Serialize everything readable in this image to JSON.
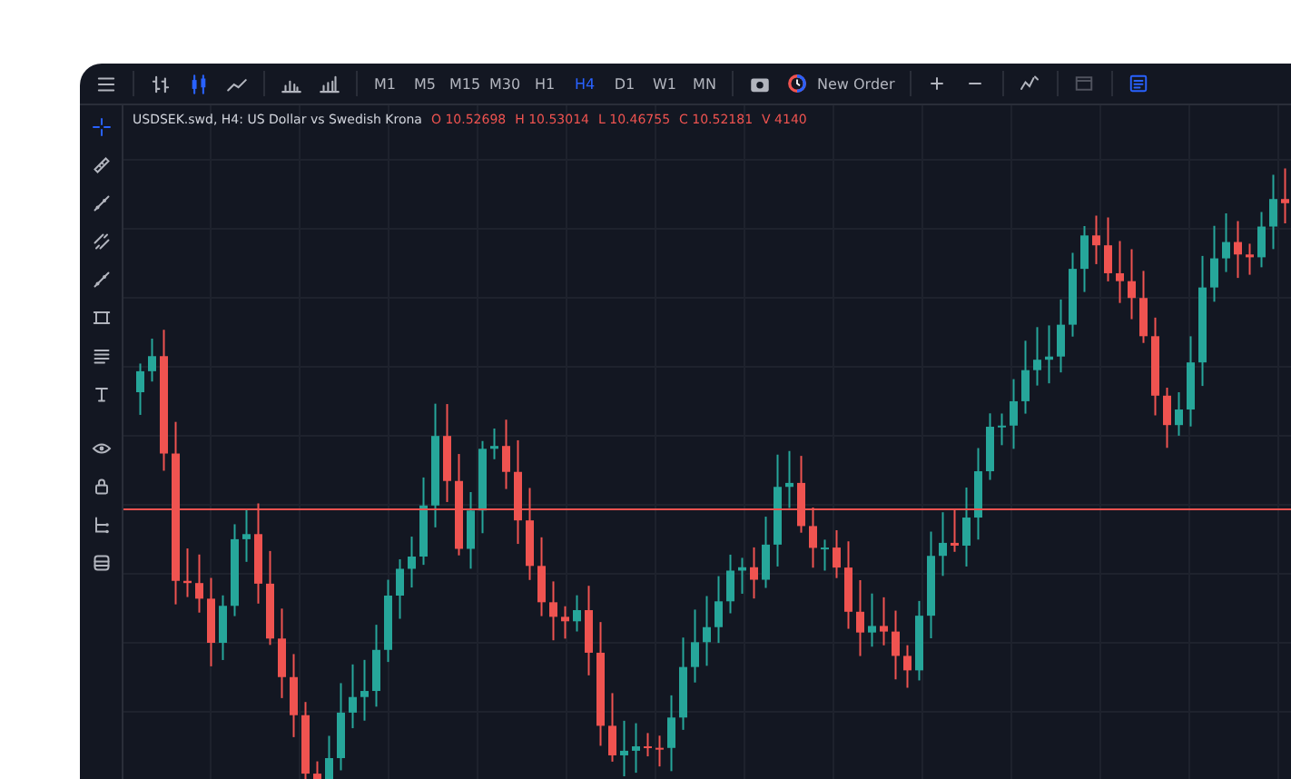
{
  "toolbar": {
    "chart_types": [
      {
        "kind": "bars",
        "selected": false
      },
      {
        "kind": "candles",
        "selected": true
      },
      {
        "kind": "line",
        "selected": false
      }
    ],
    "indicator_tools": [
      {
        "kind": "volumes"
      },
      {
        "kind": "indicator-chart"
      }
    ],
    "timeframes": [
      {
        "label": "M1",
        "selected": false
      },
      {
        "label": "M5",
        "selected": false
      },
      {
        "label": "M15",
        "selected": false
      },
      {
        "label": "M30",
        "selected": false
      },
      {
        "label": "H1",
        "selected": false
      },
      {
        "label": "H4",
        "selected": true
      },
      {
        "label": "D1",
        "selected": false
      },
      {
        "label": "W1",
        "selected": false
      },
      {
        "label": "MN",
        "selected": false
      }
    ],
    "new_order": {
      "label": "New Order"
    },
    "right_tools": [
      {
        "kind": "plus",
        "selected": false
      },
      {
        "kind": "minus",
        "selected": false
      },
      {
        "kind": "indicators",
        "selected": false
      },
      {
        "kind": "calendar",
        "selected": false
      },
      {
        "kind": "panel",
        "selected": true
      }
    ]
  },
  "drawing_tools": [
    {
      "kind": "crosshair",
      "selected": true
    },
    {
      "kind": "ruler",
      "selected": false
    },
    {
      "kind": "line",
      "selected": false
    },
    {
      "kind": "parallel",
      "selected": false
    },
    {
      "kind": "ray",
      "selected": false
    },
    {
      "kind": "rectangle",
      "selected": false
    },
    {
      "kind": "fibonacci",
      "selected": false
    },
    {
      "kind": "text",
      "selected": false
    },
    {
      "kind": "eye",
      "selected": false
    },
    {
      "kind": "lock",
      "selected": false
    },
    {
      "kind": "tree",
      "selected": false
    },
    {
      "kind": "layers",
      "selected": false
    }
  ],
  "legend": {
    "title": "USDSEK.swd, H4: US Dollar vs Swedish Krona",
    "values": [
      "O 10.52698",
      "H 10.53014",
      "L 10.46755",
      "C 10.52181",
      "V 4140"
    ]
  }
}
